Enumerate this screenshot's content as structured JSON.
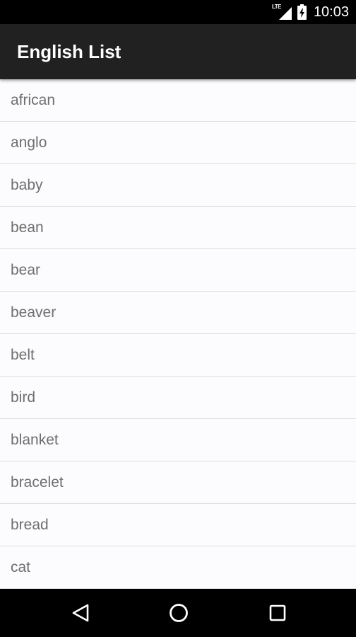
{
  "status_bar": {
    "network_label": "LTE",
    "time": "10:03",
    "icons": [
      "signal-icon",
      "battery-icon"
    ]
  },
  "app_bar": {
    "title": "English List",
    "background_color": "#212121"
  },
  "list": {
    "items": [
      "african",
      "anglo",
      "baby",
      "bean",
      "bear",
      "beaver",
      "belt",
      "bird",
      "blanket",
      "bracelet",
      "bread",
      "cat"
    ]
  },
  "nav_bar": {
    "icons": [
      "back-icon",
      "home-icon",
      "recents-icon"
    ]
  }
}
